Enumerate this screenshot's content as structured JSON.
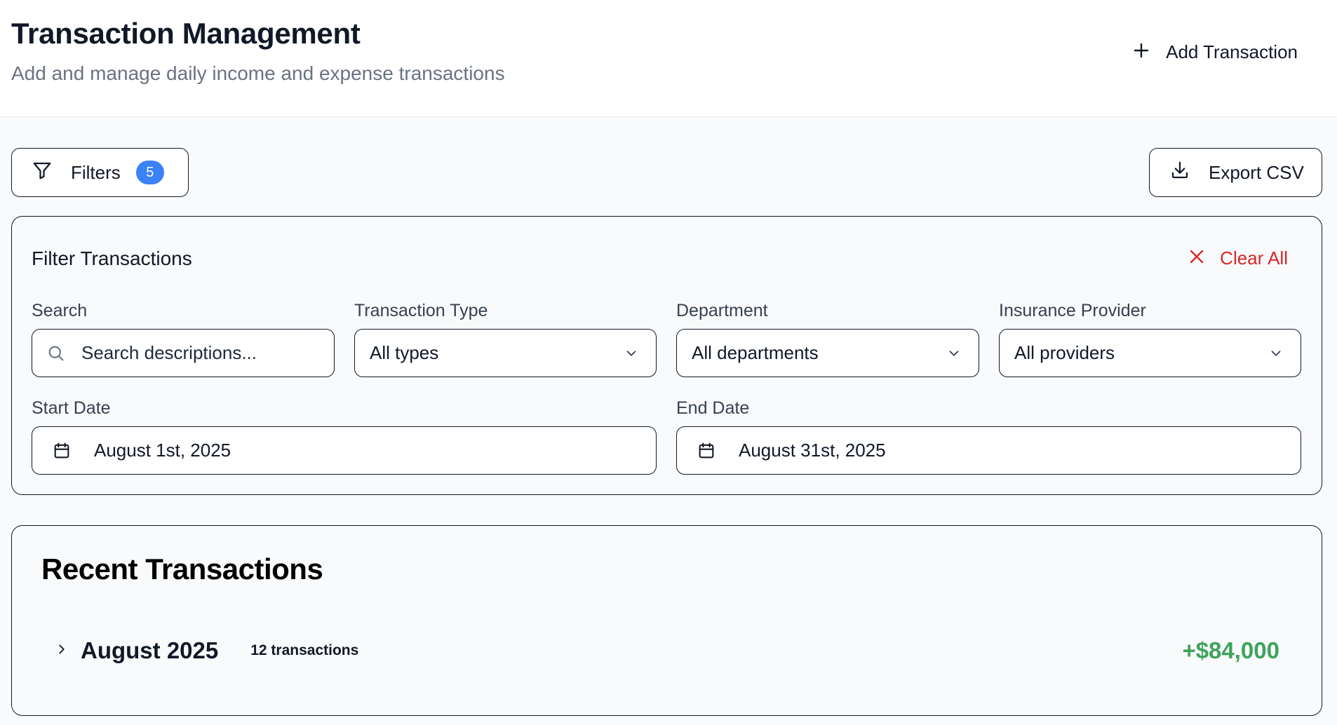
{
  "header": {
    "title": "Transaction Management",
    "subtitle": "Add and manage daily income and expense transactions",
    "add_button_label": "Add Transaction"
  },
  "toolbar": {
    "filters_label": "Filters",
    "filters_count": "5",
    "export_label": "Export CSV"
  },
  "filters": {
    "title": "Filter Transactions",
    "clear_all_label": "Clear All",
    "search": {
      "label": "Search",
      "placeholder": "Search descriptions..."
    },
    "transaction_type": {
      "label": "Transaction Type",
      "value": "All types"
    },
    "department": {
      "label": "Department",
      "value": "All departments"
    },
    "insurance_provider": {
      "label": "Insurance Provider",
      "value": "All providers"
    },
    "start_date": {
      "label": "Start Date",
      "value": "August 1st, 2025"
    },
    "end_date": {
      "label": "End Date",
      "value": "August 31st, 2025"
    }
  },
  "transactions": {
    "title": "Recent Transactions",
    "groups": [
      {
        "month": "August 2025",
        "count": "12 transactions",
        "total": "+$84,000"
      }
    ]
  },
  "colors": {
    "accent_blue": "#3b82f6",
    "danger_red": "#dc2626",
    "income_green": "#3fa35c"
  },
  "icons": [
    "plus-icon",
    "filter-icon",
    "download-icon",
    "close-icon",
    "search-icon",
    "chevron-down-icon",
    "calendar-icon",
    "chevron-right-icon"
  ]
}
